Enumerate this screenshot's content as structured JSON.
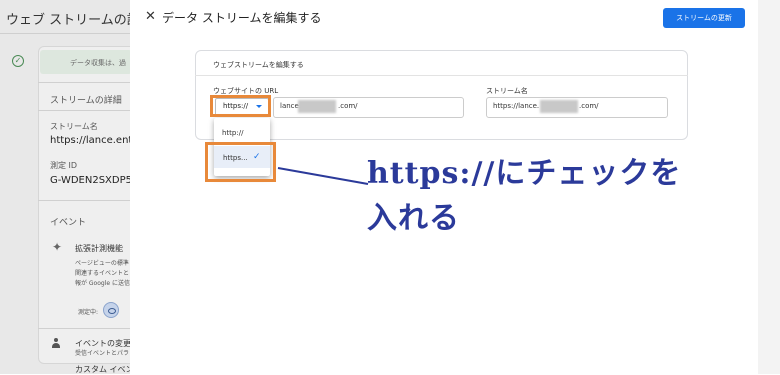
{
  "background": {
    "title": "ウェブ ストリームの詳細",
    "notice": "データ収集は、過",
    "details_heading": "ストリームの詳細",
    "stream_name_label": "ストリーム名",
    "stream_name_value": "https://lance.enta",
    "measurement_id_label": "測定 ID",
    "measurement_id_value": "G-WDEN2SXDP5",
    "events_heading": "イベント",
    "enhanced_title": "拡張計測機能",
    "enhanced_desc1": "ページビューの標準",
    "enhanced_desc2": "関連するイベントと",
    "enhanced_desc3": "報が Google に送信",
    "measuring_label": "測定中:",
    "change_title": "イベントの変更",
    "change_desc": "受信イベントとパラ",
    "custom_title": "カスタム イベン"
  },
  "panel": {
    "title": "データ ストリームを編集する",
    "update_button": "ストリームの更新",
    "card_title": "ウェブストリームを編集する",
    "url_label": "ウェブサイトの URL",
    "stream_name_label": "ストリーム名",
    "protocol_selected": "https://",
    "url_prefix": "lance.",
    "url_suffix": ".com/",
    "stream_prefix": "https://lance.",
    "stream_suffix": ".com/",
    "options": [
      "http://",
      "https..."
    ]
  },
  "annotation": {
    "line1": "https://にチェックを",
    "line2": "入れる"
  },
  "colors": {
    "accent": "#1a73e8",
    "highlight": "#e8893a",
    "annotation": "#2b3a9a"
  }
}
